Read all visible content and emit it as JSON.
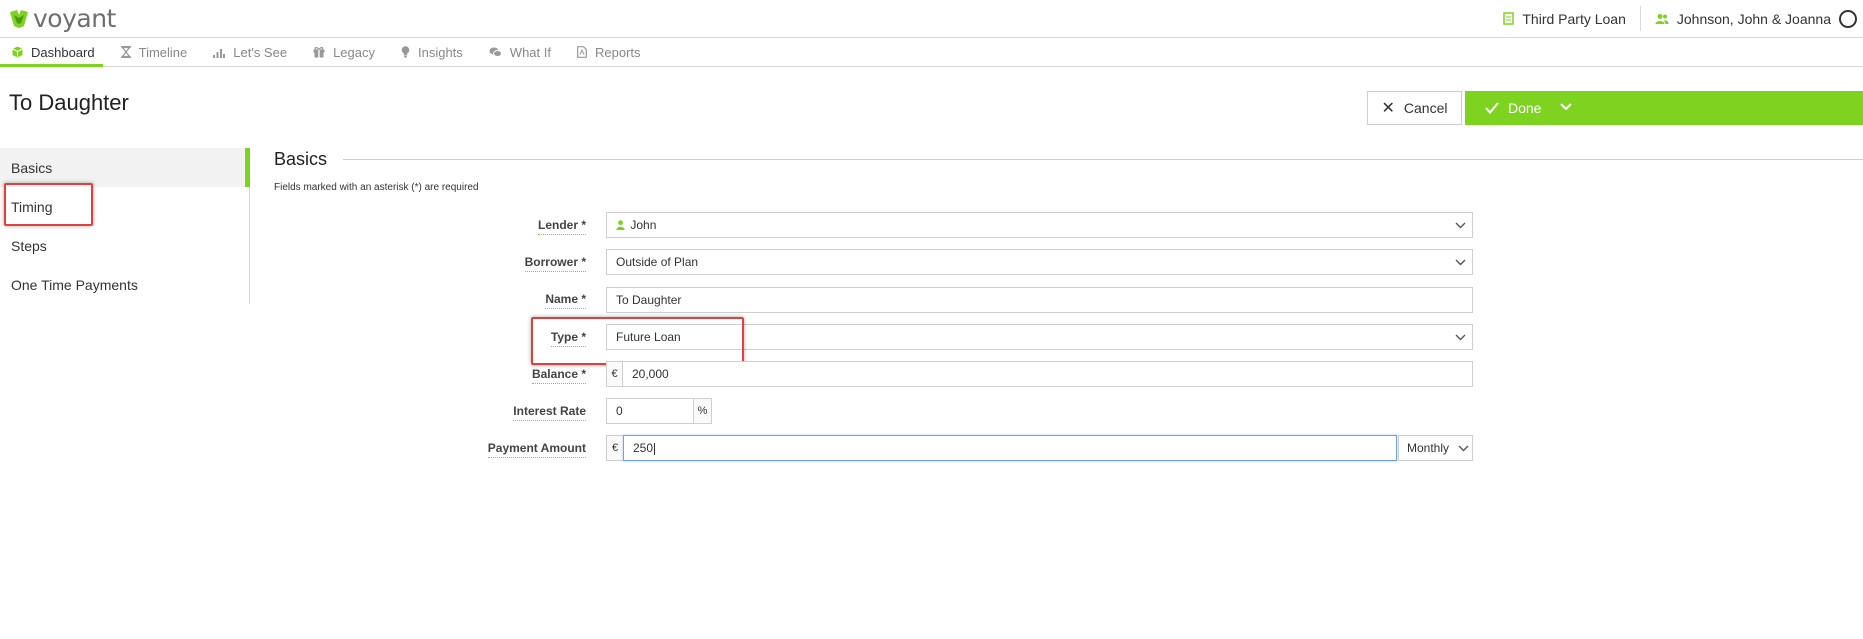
{
  "app": {
    "logo_text": "voyant"
  },
  "header": {
    "plan_name": "Third Party Loan",
    "client_name": "Johnson, John & Joanna"
  },
  "nav": {
    "tabs": [
      {
        "label": "Dashboard",
        "icon": "cube-icon",
        "active": true
      },
      {
        "label": "Timeline",
        "icon": "hourglass-icon",
        "active": false
      },
      {
        "label": "Let's See",
        "icon": "bar-chart-icon",
        "active": false
      },
      {
        "label": "Legacy",
        "icon": "gift-icon",
        "active": false
      },
      {
        "label": "Insights",
        "icon": "lightbulb-icon",
        "active": false
      },
      {
        "label": "What If",
        "icon": "chat-icon",
        "active": false
      },
      {
        "label": "Reports",
        "icon": "document-icon",
        "active": false
      }
    ]
  },
  "page": {
    "title": "To Daughter"
  },
  "actions": {
    "cancel_label": "Cancel",
    "done_label": "Done"
  },
  "sidebar": {
    "items": [
      {
        "label": "Basics",
        "active": true
      },
      {
        "label": "Timing",
        "active": false
      },
      {
        "label": "Steps",
        "active": false
      },
      {
        "label": "One Time Payments",
        "active": false
      }
    ]
  },
  "form": {
    "section_title": "Basics",
    "required_note": "Fields marked with an asterisk (*) are required",
    "lender": {
      "label": "Lender *",
      "value": "John"
    },
    "borrower": {
      "label": "Borrower *",
      "value": "Outside of Plan"
    },
    "name": {
      "label": "Name *",
      "value": "To Daughter"
    },
    "type": {
      "label": "Type *",
      "value": "Future Loan"
    },
    "balance": {
      "label": "Balance *",
      "currency": "€",
      "value": "20,000"
    },
    "interest_rate": {
      "label": "Interest Rate",
      "value": "0",
      "unit": "%"
    },
    "payment_amount": {
      "label": "Payment Amount",
      "currency": "€",
      "value": "250",
      "frequency": "Monthly"
    }
  },
  "colors": {
    "accent": "#7ed321",
    "highlight": "#e0413e",
    "focus": "#6fa3e8"
  }
}
